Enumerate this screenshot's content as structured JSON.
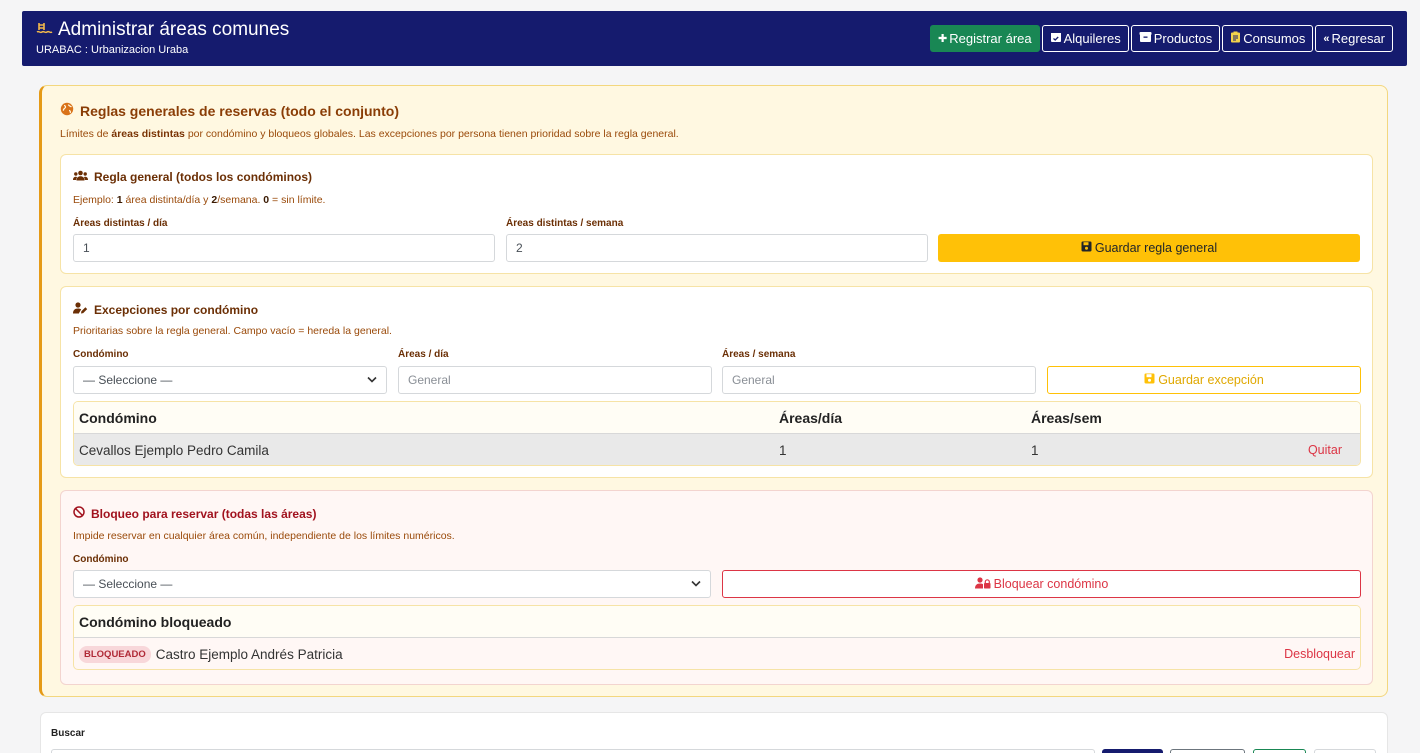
{
  "header": {
    "title": "Administrar áreas comunes",
    "subtitle": "URABAC : Urbanizacion Uraba",
    "buttons": {
      "register": "Registrar área",
      "rentals": "Alquileres",
      "products": "Productos",
      "consumptions": "Consumos",
      "back": "Regresar"
    }
  },
  "rules": {
    "title": "Reglas generales de reservas (todo el conjunto)",
    "subtitle_pre": "Límites de ",
    "subtitle_bold": "áreas distintas",
    "subtitle_post": " por condómino y bloqueos globales. Las excepciones por persona tienen prioridad sobre la regla general."
  },
  "general": {
    "title": "Regla general (todos los condóminos)",
    "example_pre": "Ejemplo: ",
    "example_b1": "1",
    "example_mid1": " área distinta/día y ",
    "example_b2": "2",
    "example_mid2": "/semana. ",
    "example_b3": "0",
    "example_post": " = sin límite.",
    "day_label": "Áreas distintas / día",
    "day_value": "1",
    "week_label": "Áreas distintas / semana",
    "week_value": "2",
    "save_label": "Guardar regla general"
  },
  "exceptions": {
    "title": "Excepciones por condómino",
    "subtitle": "Prioritarias sobre la regla general. Campo vacío = hereda la general.",
    "owner_label": "Condómino",
    "owner_select": "— Seleccione —",
    "day_label": "Áreas / día",
    "day_placeholder": "General",
    "week_label": "Áreas / semana",
    "week_placeholder": "General",
    "save_label": "Guardar excepción",
    "table": {
      "headers": [
        "Condómino",
        "Áreas/día",
        "Áreas/sem"
      ],
      "rows": [
        {
          "owner": "Cevallos Ejemplo Pedro Camila",
          "day": "1",
          "week": "1",
          "action": "Quitar"
        }
      ]
    }
  },
  "block": {
    "title": "Bloqueo para reservar (todas las áreas)",
    "subtitle": "Impide reservar en cualquier área común, independiente de los límites numéricos.",
    "owner_label": "Condómino",
    "owner_select": "— Seleccione —",
    "block_label": "Bloquear condómino",
    "table": {
      "header": "Condómino bloqueado",
      "rows": [
        {
          "badge": "BLOQUEADO",
          "owner": "Castro Ejemplo Andrés Patricia",
          "action": "Desbloquear"
        }
      ]
    }
  },
  "search": {
    "label": "Buscar"
  }
}
